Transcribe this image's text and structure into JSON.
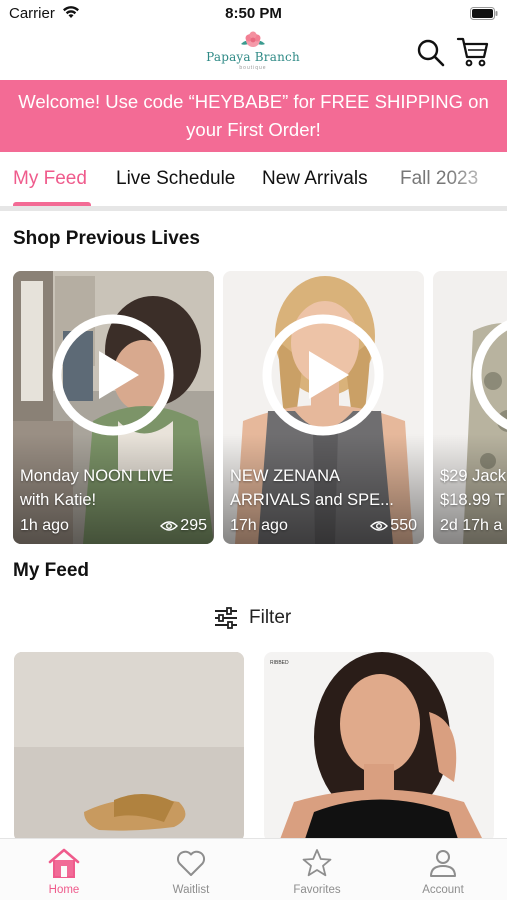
{
  "status_bar": {
    "carrier": "Carrier",
    "time": "8:50 PM"
  },
  "header": {
    "logo_text": "Papaya Branch",
    "logo_subtext": "boutique"
  },
  "promo": {
    "line1": "Welcome! Use code “HEYBABE”  for FREE SHIPPING on",
    "line2": "your First Order!"
  },
  "tabs": [
    {
      "label": "My Feed",
      "active": true
    },
    {
      "label": "Live Schedule"
    },
    {
      "label": "New Arrivals"
    },
    {
      "label": "Fall 2023"
    }
  ],
  "lives_section": {
    "title": "Shop Previous Lives",
    "cards": [
      {
        "title_line1": "Monday NOON LIVE",
        "title_line2": "with Katie!",
        "time": "1h ago",
        "views": "295"
      },
      {
        "title_line1": "NEW ZENANA",
        "title_line2": "ARRIVALS and SPE...",
        "time": "17h ago",
        "views": "550"
      },
      {
        "title_line1": "$29 Jack",
        "title_line2": "$18.99 T",
        "time": "2d 17h a",
        "views": ""
      }
    ]
  },
  "feed_section": {
    "title": "My Feed",
    "filter_label": "Filter",
    "product_tag": "RIBBED"
  },
  "bottom_nav": [
    {
      "label": "Home",
      "icon": "home-icon",
      "active": true
    },
    {
      "label": "Waitlist",
      "icon": "heart-icon"
    },
    {
      "label": "Favorites",
      "icon": "star-icon"
    },
    {
      "label": "Account",
      "icon": "account-icon"
    }
  ],
  "colors": {
    "brand_pink": "#f36b95",
    "active_pink": "#ef5b8c",
    "logo_teal": "#2f8a86"
  }
}
